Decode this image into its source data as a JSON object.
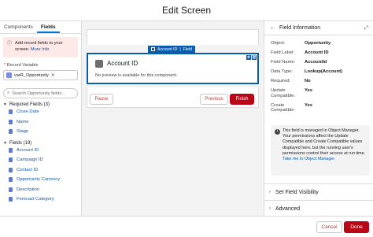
{
  "window": {
    "title": "Edit Screen"
  },
  "left": {
    "tabs": [
      "Components",
      "Fields"
    ],
    "info": {
      "text": "Add record fields to your screen.",
      "link": "More Info"
    },
    "record_variable_label": "Record Variable",
    "required_mark": "*",
    "record_variable_value": "varR_Opportunity",
    "search_placeholder": "Search Opportunity fields...",
    "required_section": "Required Fields (3)",
    "required_fields": [
      "Close Date",
      "Name",
      "Stage"
    ],
    "fields_section": "Fields (19)",
    "fields": [
      "Account ID",
      "Campaign ID",
      "Contact ID",
      "Opportunity Currency",
      "Description",
      "Forecast Category"
    ]
  },
  "canvas": {
    "component_tag": "Account ID",
    "component_tag_type": "Field",
    "component_title": "Account ID",
    "component_desc": "No preview is available for this component.",
    "buttons": {
      "pause": "Pause",
      "previous": "Previous",
      "finish": "Finish"
    }
  },
  "right": {
    "header": "Field Information",
    "props": [
      {
        "k": "Object:",
        "v": "Opportunity"
      },
      {
        "k": "Field Label:",
        "v": "Account ID"
      },
      {
        "k": "Field Name:",
        "v": "AccountId"
      },
      {
        "k": "Data Type:",
        "v": "Lookup(Account)"
      },
      {
        "k": "Required:",
        "v": "No"
      },
      {
        "k": "Update Compatible:",
        "v": "Yes"
      },
      {
        "k": "Create Compatible:",
        "v": "Yes"
      }
    ],
    "notice": {
      "text": "This field is managed in Object Manager. Your permissions affect the Update Compatible and Create Compatible values displayed here, but the running user's permissions control their access at run time.",
      "link": "Take me to Object Manager"
    },
    "sections": [
      "Set Field Visibility",
      "Advanced"
    ]
  },
  "footer": {
    "cancel": "Cancel",
    "done": "Done"
  },
  "colors": {
    "brand_blue": "#0b5cab",
    "destructive": "#ba0517",
    "info_bg": "#fde9e7"
  }
}
